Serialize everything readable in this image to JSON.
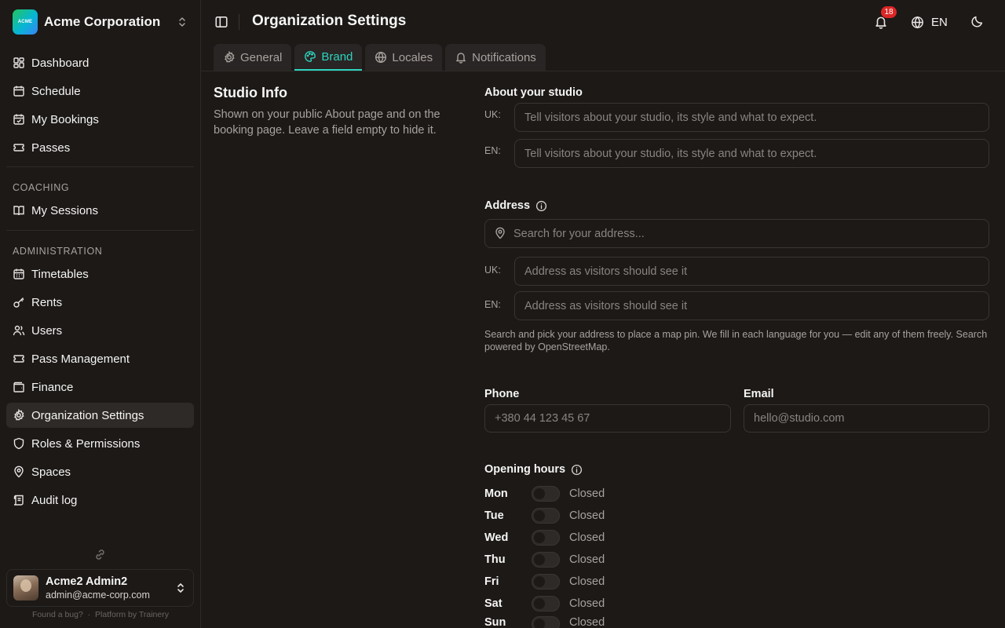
{
  "org": {
    "name": "Acme Corporation",
    "logo_text": "ACME",
    "logo_colors": [
      "#22c55e",
      "#06b6d4",
      "#3b82f6"
    ]
  },
  "sidebar": {
    "main_items": [
      {
        "label": "Dashboard",
        "icon": "dashboard-icon"
      },
      {
        "label": "Schedule",
        "icon": "calendar-icon"
      },
      {
        "label": "My Bookings",
        "icon": "calendar-check-icon"
      },
      {
        "label": "Passes",
        "icon": "ticket-icon"
      }
    ],
    "coaching_title": "COACHING",
    "coaching_items": [
      {
        "label": "My Sessions",
        "icon": "book-open-icon"
      }
    ],
    "admin_title": "ADMINISTRATION",
    "admin_items": [
      {
        "label": "Timetables",
        "icon": "calendar-grid-icon"
      },
      {
        "label": "Rents",
        "icon": "key-icon"
      },
      {
        "label": "Users",
        "icon": "users-icon"
      },
      {
        "label": "Pass Management",
        "icon": "ticket-icon"
      },
      {
        "label": "Finance",
        "icon": "wallet-icon"
      },
      {
        "label": "Organization Settings",
        "icon": "gear-icon",
        "active": true
      },
      {
        "label": "Roles & Permissions",
        "icon": "shield-icon"
      },
      {
        "label": "Spaces",
        "icon": "map-pin-icon"
      },
      {
        "label": "Audit log",
        "icon": "scroll-icon"
      }
    ]
  },
  "user": {
    "name": "Acme2 Admin2",
    "email": "admin@acme-corp.com"
  },
  "footer": {
    "bug": "Found a bug?",
    "sep": "·",
    "platform": "Platform by Trainery"
  },
  "header": {
    "title": "Organization Settings",
    "notifications": "18",
    "language": "EN"
  },
  "tabs": [
    {
      "label": "General",
      "icon": "gear-icon"
    },
    {
      "label": "Brand",
      "icon": "palette-icon",
      "active": true
    },
    {
      "label": "Locales",
      "icon": "globe-icon"
    },
    {
      "label": "Notifications",
      "icon": "bell-icon"
    }
  ],
  "accent_color": "#2dd4bf",
  "section": {
    "title": "Studio Info",
    "description": "Shown on your public About page and on the booking page. Leave a field empty to hide it."
  },
  "about": {
    "label": "About your studio",
    "uk_tag": "UK:",
    "uk_placeholder": "Tell visitors about your studio, its style and what to expect.",
    "en_tag": "EN:",
    "en_placeholder": "Tell visitors about your studio, its style and what to expect."
  },
  "address": {
    "label": "Address",
    "search_placeholder": "Search for your address...",
    "uk_tag": "UK:",
    "uk_placeholder": "Address as visitors should see it",
    "en_tag": "EN:",
    "en_placeholder": "Address as visitors should see it",
    "help": "Search and pick your address to place a map pin. We fill in each language for you — edit any of them freely. Search powered by OpenStreetMap."
  },
  "phone": {
    "label": "Phone",
    "placeholder": "+380 44 123 45 67"
  },
  "email": {
    "label": "Email",
    "placeholder": "hello@studio.com"
  },
  "hours": {
    "label": "Opening hours",
    "days": [
      {
        "day": "Mon",
        "status": "Closed"
      },
      {
        "day": "Tue",
        "status": "Closed"
      },
      {
        "day": "Wed",
        "status": "Closed"
      },
      {
        "day": "Thu",
        "status": "Closed"
      },
      {
        "day": "Fri",
        "status": "Closed"
      },
      {
        "day": "Sat",
        "status": "Closed"
      },
      {
        "day": "Sun",
        "status": "Closed"
      }
    ]
  }
}
